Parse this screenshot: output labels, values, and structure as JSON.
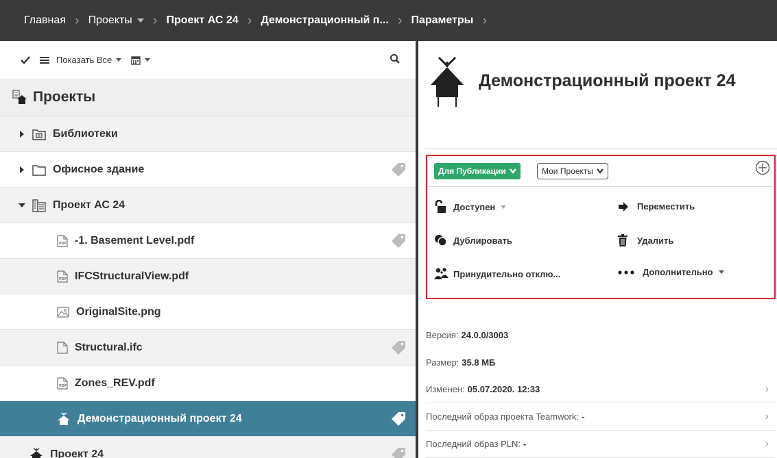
{
  "breadcrumb": {
    "items": [
      {
        "label": "Главная"
      },
      {
        "label": "Проекты"
      },
      {
        "label": "Проект АС 24"
      },
      {
        "label": "Демонстрационный п..."
      },
      {
        "label": "Параметры"
      }
    ]
  },
  "toolbar": {
    "show_all_label": "Показать Все"
  },
  "tree": {
    "title": "Проекты",
    "items": [
      {
        "label": "Библиотеки",
        "icon": "library-folder-icon",
        "tagged": false
      },
      {
        "label": "Офисное здание",
        "icon": "folder-icon",
        "tagged": true
      },
      {
        "label": "Проект АС 24",
        "icon": "building-icon",
        "tagged": false
      },
      {
        "label": "-1. Basement Level.pdf",
        "icon": "pdf-file-icon",
        "tagged": true
      },
      {
        "label": "IFCStructuralView.pdf",
        "icon": "pdf-file-icon",
        "tagged": false
      },
      {
        "label": "OriginalSite.png",
        "icon": "image-file-icon",
        "tagged": false
      },
      {
        "label": "Structural.ifc",
        "icon": "file-icon",
        "tagged": true
      },
      {
        "label": "Zones_REV.pdf",
        "icon": "pdf-file-icon",
        "tagged": false
      },
      {
        "label": "Демонстрационный проект 24",
        "icon": "house-project-icon",
        "tagged": true,
        "selected": true
      },
      {
        "label": "Проект 24",
        "icon": "house-project-icon",
        "tagged": true
      }
    ]
  },
  "detail": {
    "title": "Демонстрационный проект 24",
    "filter_publication": "Для Публикации",
    "filter_my_projects": "Мои Проекты",
    "actions": {
      "available": "Доступен",
      "move": "Переместить",
      "duplicate": "Дублировать",
      "delete": "Удалить",
      "force_disconnect": "Принудительно отклю...",
      "more": "Дополнительно"
    },
    "info": {
      "version_label": "Версия:",
      "version_value": "24.0.0/3003",
      "size_label": "Размер:",
      "size_value": "35.8 МБ",
      "modified_label": "Изменен:",
      "modified_value": "05.07.2020. 12:33",
      "teamwork_label": "Последний образ проекта Teamwork:",
      "teamwork_value": "-",
      "pln_label": "Последний образ PLN:",
      "pln_value": "-"
    }
  },
  "colors": {
    "topbar_bg": "#3a3a3a",
    "selected_row": "#3f7f99",
    "publish_green": "#2ea86a",
    "highlight_red": "#e01e2b"
  }
}
